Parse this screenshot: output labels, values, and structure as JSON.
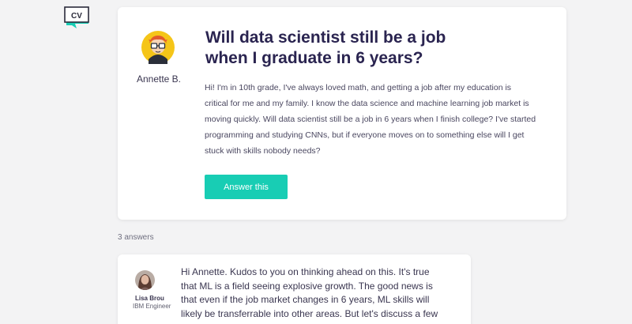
{
  "logo": {
    "text": "CV",
    "color": "#18cdb4"
  },
  "question": {
    "asker_name": "Annette B.",
    "title_line1": "Will data scientist still be a job",
    "title_line2": "when I graduate in 6 years?",
    "body": "Hi! I'm in 10th grade, I've always loved math, and getting a job after my education is critical for me and my family. I know the data science and machine learning job market is moving quickly. Will data scientist still be a job in 6 years when I finish college? I've started programming and studying CNNs, but if everyone moves on to something else will I get stuck with skills nobody needs?",
    "answer_button_label": "Answer this"
  },
  "answers": {
    "count_label": "3 answers",
    "items": [
      {
        "name": "Lisa Brou",
        "role": "IBM Engineer",
        "text": "Hi Annette. Kudos to you on thinking ahead on this. It's true that ML is a field seeing explosive growth. The good news is that even if the job market changes in 6 years, ML skills will likely be transferrable into other areas. But let's discuss a few reasons…"
      }
    ]
  },
  "colors": {
    "accent": "#18cdb4",
    "title": "#2a2450",
    "background": "#f3f3f4"
  }
}
